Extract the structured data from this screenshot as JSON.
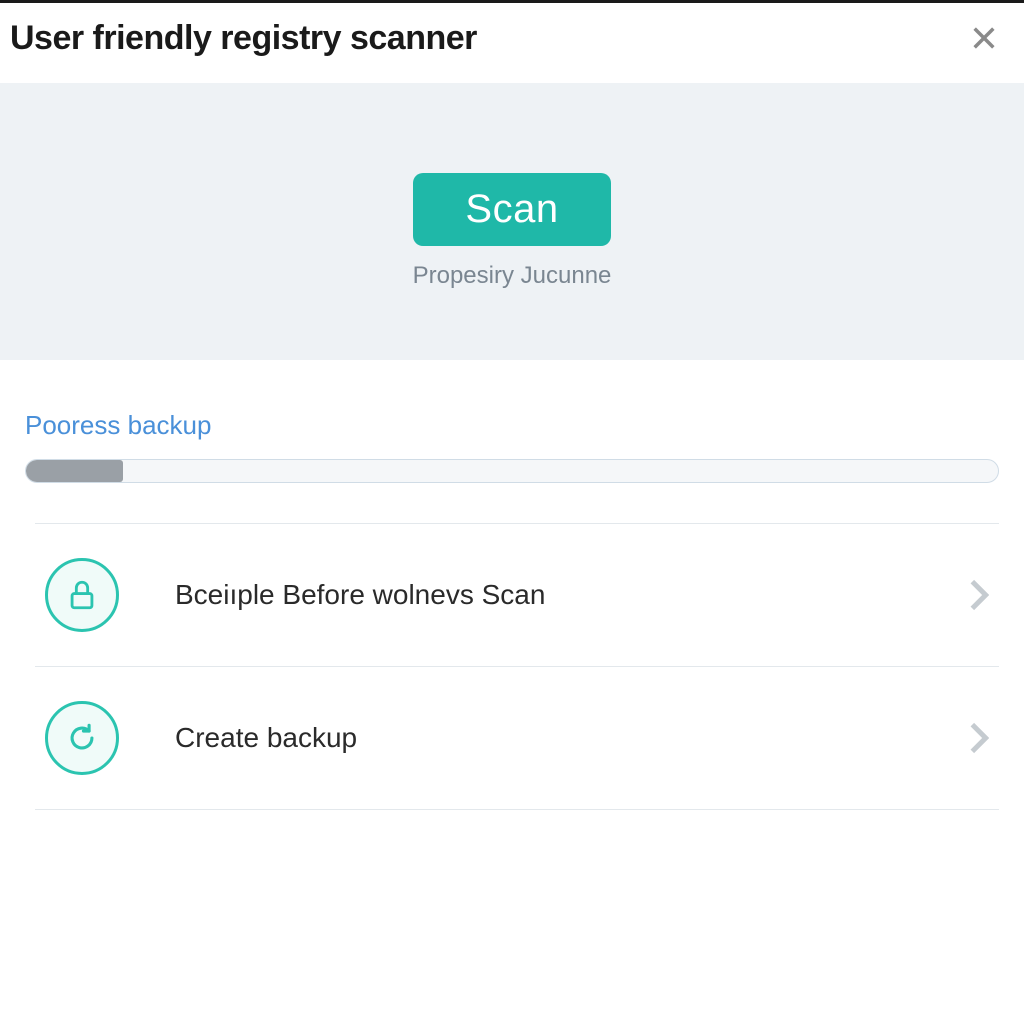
{
  "header": {
    "title": "User friendly registry scanner"
  },
  "scan": {
    "button_label": "Scan",
    "subtext": "Propesiry Jucunne"
  },
  "progress": {
    "label": "Pooress backup",
    "percent": 10
  },
  "options": [
    {
      "icon": "lock-icon",
      "label": "Bceiıple Before wolnevs Scan"
    },
    {
      "icon": "refresh-icon",
      "label": "Create backup"
    }
  ],
  "colors": {
    "accent": "#1fb8a8",
    "panel_bg": "#eef2f5",
    "link": "#4a90d9"
  }
}
